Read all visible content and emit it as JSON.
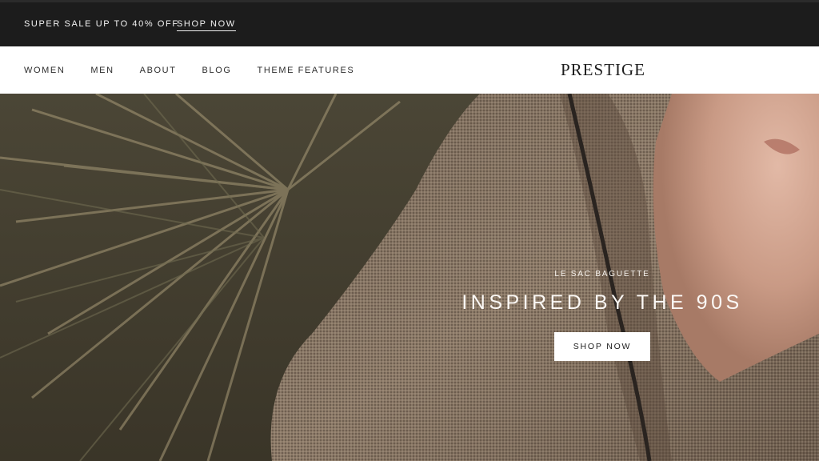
{
  "announcement": {
    "text": "SUPER SALE UP TO 40% OFF",
    "link_label": "SHOP NOW"
  },
  "header": {
    "nav": [
      {
        "label": "WOMEN"
      },
      {
        "label": "MEN"
      },
      {
        "label": "ABOUT"
      },
      {
        "label": "BLOG"
      },
      {
        "label": "THEME FEATURES"
      }
    ],
    "logo": "PRESTIGE"
  },
  "hero": {
    "subheading": "LE SAC BAGUETTE",
    "heading": "INSPIRED BY THE 90S",
    "button_label": "SHOP NOW"
  },
  "colors": {
    "announcement_bg": "#1c1c1c",
    "header_bg": "#ffffff",
    "button_bg": "#ffffff",
    "text_dark": "#1c1c1c"
  }
}
